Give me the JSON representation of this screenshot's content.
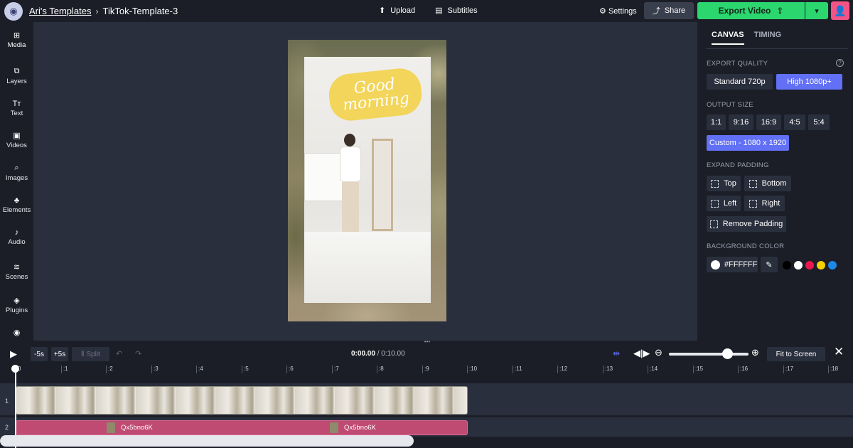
{
  "topbar": {
    "breadcrumb_parent": "Ari's Templates",
    "breadcrumb_separator": "›",
    "project_title": "TikTok-Template-3",
    "upload_label": "Upload",
    "subtitles_label": "Subtitles",
    "settings_label": "Settings",
    "share_label": "Share",
    "export_label": "Export Video"
  },
  "leftnav": {
    "items": [
      {
        "label": "Media",
        "icon": "media-icon"
      },
      {
        "label": "Layers",
        "icon": "layers-icon"
      },
      {
        "label": "Text",
        "icon": "text-icon"
      },
      {
        "label": "Videos",
        "icon": "videos-icon"
      },
      {
        "label": "Images",
        "icon": "search-icon"
      },
      {
        "label": "Elements",
        "icon": "elements-icon"
      },
      {
        "label": "Audio",
        "icon": "music-note-icon"
      },
      {
        "label": "Scenes",
        "icon": "scenes-icon"
      },
      {
        "label": "Plugins",
        "icon": "plugins-icon"
      }
    ]
  },
  "canvas": {
    "sticker_line1": "Good",
    "sticker_line2": "morning"
  },
  "rightpanel": {
    "tab_canvas": "CANVAS",
    "tab_timing": "TIMING",
    "export_quality_heading": "EXPORT QUALITY",
    "quality_standard": "Standard 720p",
    "quality_high": "High 1080p+",
    "output_size_heading": "OUTPUT SIZE",
    "sizes": [
      "1:1",
      "9:16",
      "16:9",
      "4:5",
      "5:4"
    ],
    "custom_size": "Custom - 1080 x 1920",
    "expand_padding_heading": "EXPAND PADDING",
    "pad_top": "Top",
    "pad_bottom": "Bottom",
    "pad_left": "Left",
    "pad_right": "Right",
    "pad_remove": "Remove Padding",
    "background_heading": "BACKGROUND COLOR",
    "background_value": "#FFFFFF",
    "swatches": [
      "#000000",
      "#ffffff",
      "#e8174d",
      "#f5d000",
      "#1e88e5"
    ]
  },
  "timeline": {
    "back_label": "-5s",
    "fwd_label": "+5s",
    "split_label": "Split",
    "current_time": "0:00.00",
    "time_separator": " / ",
    "duration": "0:10.00",
    "fit_label": "Fit to Screen",
    "ruler": [
      "0",
      ":1",
      ":2",
      ":3",
      ":4",
      ":5",
      ":6",
      ":7",
      ":8",
      ":9",
      ":10",
      ":11",
      ":12",
      ":13",
      ":14",
      ":15",
      ":16",
      ":17",
      ":18"
    ],
    "track1_label": "1",
    "track2_label": "2",
    "audio_clip_a": "Qx5bno6K",
    "audio_clip_b": "Qx5bno6K"
  }
}
